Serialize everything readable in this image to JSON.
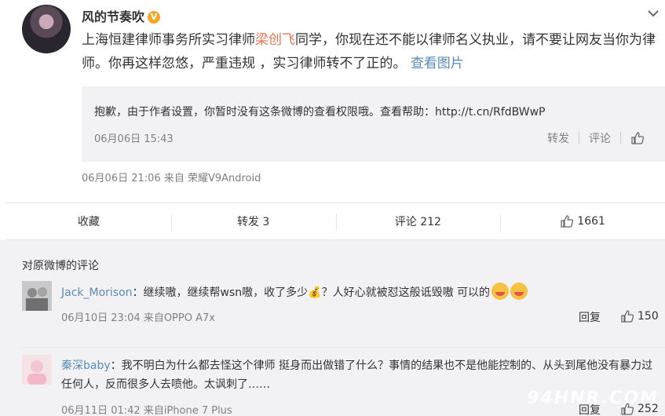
{
  "post": {
    "author": "风的节奏吹",
    "verified_badge": "V",
    "text_parts": {
      "before": "上海恒建律师事务所实习律师",
      "mention": "梁创飞",
      "after": "同学，你现在还不能以律师名义执业，请不要让网友当你为律师。你再这样忽悠，严重违规 ，实习律师转不了正的。",
      "view_image": "查看图片"
    },
    "quote": {
      "text": "抱歉，由于作者设置，你暂时没有这条微博的查看权限哦。查看帮助：http://t.cn/RfdBWwP",
      "time": "06月06日 15:43",
      "forward": "转发",
      "comment": "评论"
    },
    "meta": "06月06日 21:06  来自 荣耀V9Android"
  },
  "actions": {
    "favorite": "收藏",
    "forward": "转发 3",
    "comment": "评论 212",
    "like": "1661"
  },
  "comments": {
    "title": "对原微博的评论",
    "items": [
      {
        "user": "Jack_Morison",
        "text": "：继续嗷，继续帮wsn嗷，收了多少💰？人好心就被怼这般诋毁嗷 可以的",
        "time": "06月10日 23:04 来自OPPO A7x",
        "reply": "回复",
        "likes": "150"
      },
      {
        "user": "秦深baby",
        "text": "：我不明白为什么都去怪这个律师 挺身而出做错了什么？事情的结果也不是他能控制的、从头到尾他没有暴力过任何人，反而很多人去喷他。太讽刺了……",
        "time": "06月11日 01:42 来自iPhone 7 Plus",
        "reply": "回复",
        "likes": "252"
      }
    ]
  },
  "watermark": "94HNR.COM",
  "colors": {
    "link": "#5a8bb6",
    "mention": "#eb7350",
    "muted": "#808080",
    "panel": "#f2f2f5"
  }
}
